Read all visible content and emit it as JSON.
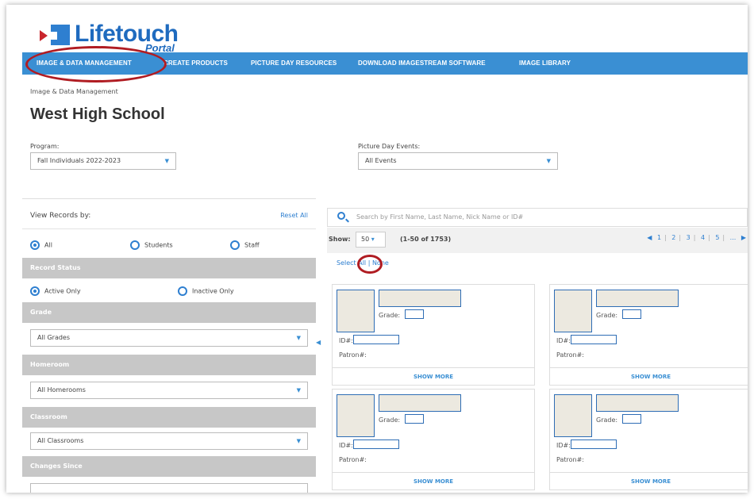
{
  "logo": {
    "title": "Lifetouch",
    "subtitle": "Portal"
  },
  "nav": {
    "items": [
      "IMAGE & DATA MANAGEMENT",
      "CREATE PRODUCTS",
      "PICTURE DAY RESOURCES",
      "DOWNLOAD IMAGESTREAM SOFTWARE",
      "IMAGE LIBRARY"
    ],
    "color": "#3a8fd3",
    "highlight_color": "#b01c22"
  },
  "breadcrumb": "Image & Data Management",
  "page_title": "West High School",
  "filters": {
    "program_label": "Program:",
    "program_value": "Fall Individuals 2022-2023",
    "events_label": "Picture Day Events:",
    "events_value": "All Events"
  },
  "left_panel": {
    "title": "View Records by:",
    "reset": "Reset All",
    "record_types": [
      "All",
      "Students",
      "Staff"
    ],
    "selected_type": "All",
    "record_status_header": "Record Status",
    "status_options": [
      "Active Only",
      "Inactive Only"
    ],
    "selected_status": "Active Only",
    "grade_header": "Grade",
    "grade_value": "All Grades",
    "homeroom_header": "Homeroom",
    "homeroom_value": "All Homerooms",
    "classroom_header": "Classroom",
    "classroom_value": "All Classrooms",
    "changes_header": "Changes Since"
  },
  "search": {
    "placeholder": "Search by First Name, Last Name, Nick Name or ID#"
  },
  "toolbar": {
    "show_label": "Show:",
    "show_value": "50",
    "range": "(1-50 of 1753)",
    "pages": [
      "1",
      "2",
      "3",
      "4",
      "5",
      "..."
    ]
  },
  "select": {
    "label": "Select",
    "all": "All",
    "none": "None"
  },
  "cards": [
    {
      "grade_label": "Grade:",
      "id_label": "ID#:",
      "patron_label": "Patron#:",
      "more": "SHOW MORE"
    },
    {
      "grade_label": "Grade:",
      "id_label": "ID#:",
      "patron_label": "Patron#:",
      "more": "SHOW MORE"
    },
    {
      "grade_label": "Grade:",
      "id_label": "ID#:",
      "patron_label": "Patron#:",
      "more": "SHOW MORE"
    },
    {
      "grade_label": "Grade:",
      "id_label": "ID#:",
      "patron_label": "Patron#:",
      "more": "SHOW MORE"
    }
  ]
}
